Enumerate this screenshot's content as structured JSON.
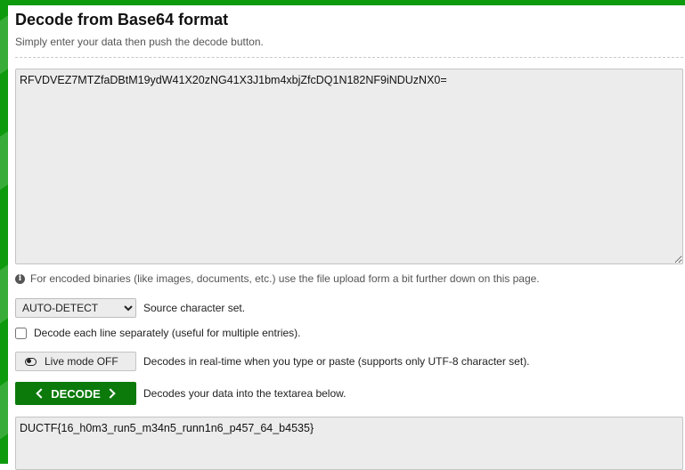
{
  "header": {
    "title": "Decode from Base64 format",
    "subtitle": "Simply enter your data then push the decode button."
  },
  "input": {
    "value": "RFVDVEZ7MTZfaDBtM19ydW41X20zNG41X3J1bm4xbjZfcDQ1N182NF9iNDUzNX0="
  },
  "info": {
    "icon": "info-icon",
    "text": "For encoded binaries (like images, documents, etc.) use the file upload form a bit further down on this page."
  },
  "charset": {
    "selected": "AUTO-DETECT",
    "label": "Source character set."
  },
  "separate_lines": {
    "checked": false,
    "label": "Decode each line separately (useful for multiple entries)."
  },
  "live_mode": {
    "button_label": "Live mode OFF",
    "icon": "toggle-icon",
    "description": "Decodes in real-time when you type or paste (supports only UTF-8 character set)."
  },
  "decode": {
    "button_label": "DECODE",
    "description": "Decodes your data into the textarea below."
  },
  "output": {
    "value": "DUCTF{16_h0m3_run5_m34n5_runn1n6_p457_64_b4535}"
  },
  "colors": {
    "accent": "#0d9a0d",
    "button": "#0b7a0b",
    "field_bg": "#ececec"
  }
}
